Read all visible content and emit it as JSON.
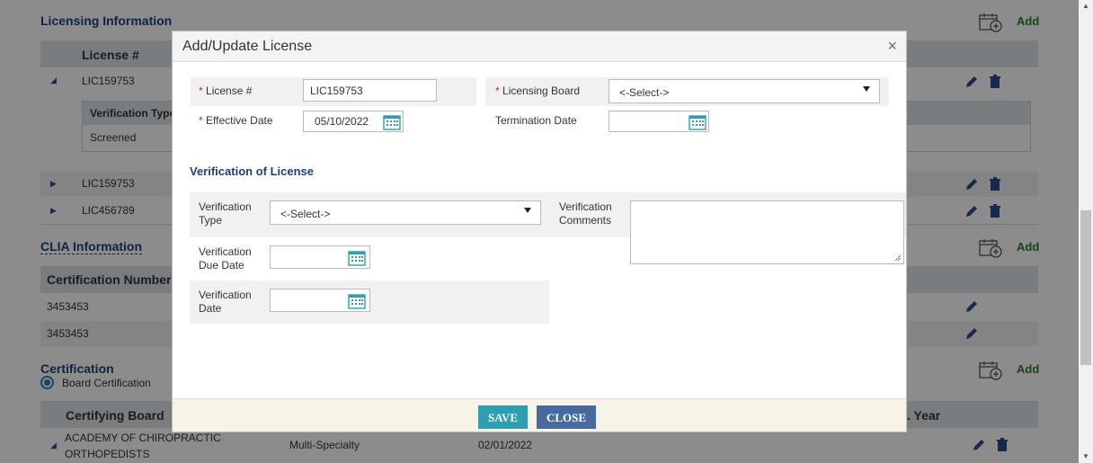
{
  "licensing": {
    "title": "Licensing Information",
    "add_label": "Add",
    "column_license": "License #",
    "rows": [
      {
        "license": "LIC159753",
        "expanded": true
      },
      {
        "license": "LIC159753",
        "expanded": false
      },
      {
        "license": "LIC456789",
        "expanded": false
      }
    ],
    "sub_table": {
      "column": "Verification Type",
      "value": "Screened"
    }
  },
  "clia": {
    "title": "CLIA Information",
    "add_label": "Add",
    "column": "Certification Number",
    "rows": [
      "3453453",
      "3453453"
    ]
  },
  "certification": {
    "title": "Certification",
    "add_label": "Add",
    "radio_label": "Board Certification",
    "column_board": "Certifying Board",
    "column_year": ". Year",
    "row": {
      "board_line1": "ACADEMY OF CHIROPRACTIC",
      "board_line2": "ORTHOPEDISTS",
      "specialty": "Multi-Specialty",
      "date": "02/01/2022"
    }
  },
  "modal": {
    "title": "Add/Update License",
    "close_glyph": "×",
    "license_label": "License #",
    "license_value": "LIC159753",
    "board_label": "Licensing Board",
    "board_value": "<-Select->",
    "effective_label": "Effective Date",
    "effective_value": "05/10/2022",
    "termination_label": "Termination Date",
    "termination_value": "",
    "verification_heading": "Verification of License",
    "vtype_label_1": "Verification",
    "vtype_label_2": "Type",
    "vtype_value": "<-Select->",
    "vcomments_label_1": "Verification",
    "vcomments_label_2": "Comments",
    "vdue_label_1": "Verification",
    "vdue_label_2": "Due Date",
    "vdate_label_1": "Verification",
    "vdate_label_2": "Date",
    "required_mark": "*",
    "save_label": "SAVE",
    "close_label": "CLOSE"
  },
  "colors": {
    "accent_teal": "#2c9fb0",
    "accent_blue": "#476b9e",
    "heading_blue": "#1f3f7a",
    "required_red": "#d9261c",
    "add_green": "#2f7a2f"
  },
  "icons": [
    "calendar-add-icon",
    "pencil-icon",
    "trash-icon",
    "calendar-icon",
    "close-icon",
    "caret-down-icon",
    "expand-arrow-icon",
    "collapse-arrow-icon",
    "radio-checked-icon"
  ]
}
